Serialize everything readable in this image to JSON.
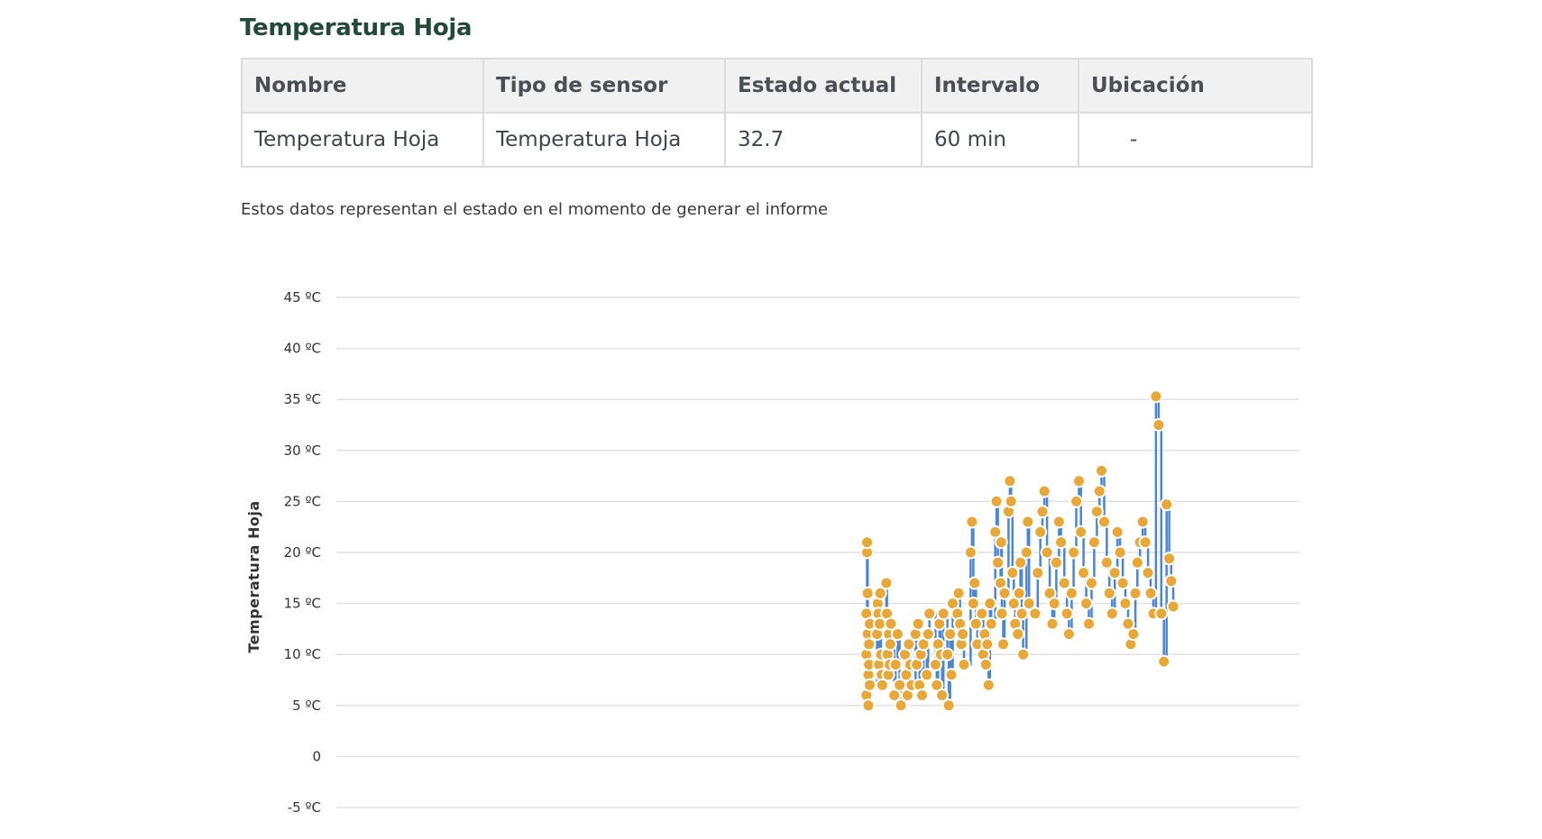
{
  "section_title": "Temperatura Hoja",
  "table": {
    "headers": [
      "Nombre",
      "Tipo de sensor",
      "Estado actual",
      "Intervalo",
      "Ubicación"
    ],
    "row": [
      "Temperatura Hoja",
      "Temperatura Hoja",
      "32.7",
      "60 min",
      "-"
    ]
  },
  "note": "Estos datos representan el estado en el momento de generar el informe",
  "colors": {
    "title": "#22493a",
    "line": "#4a86d6",
    "marker": "#e8a838",
    "grid": "#e2e2e2"
  },
  "chart_data": {
    "type": "line",
    "ylabel": "Temperatura Hoja",
    "ylim": [
      -5,
      45
    ],
    "yticks": [
      {
        "value": 45,
        "label": "45 ºC"
      },
      {
        "value": 40,
        "label": "40 ºC"
      },
      {
        "value": 35,
        "label": "35 ºC"
      },
      {
        "value": 30,
        "label": "30 ºC"
      },
      {
        "value": 25,
        "label": "25 ºC"
      },
      {
        "value": 20,
        "label": "20 ºC"
      },
      {
        "value": 15,
        "label": "15 ºC"
      },
      {
        "value": 10,
        "label": "10 ºC"
      },
      {
        "value": 5,
        "label": "5 ºC"
      },
      {
        "value": 0,
        "label": "0"
      },
      {
        "value": -5,
        "label": "-5 ºC"
      }
    ],
    "grid": true,
    "xlim": [
      0,
      100
    ],
    "series": [
      {
        "x": [
          79.8,
          79.8,
          79.8,
          79.9,
          79.9,
          80.0,
          80.0,
          80.1,
          80.1,
          80.2,
          80.2,
          80.3,
          80.3,
          81.4,
          81.5,
          81.6,
          81.7,
          81.8,
          81.9,
          82.0,
          82.1,
          82.2,
          82.8,
          82.9,
          83.0,
          83.1,
          83.2,
          83.3,
          83.4,
          83.5,
          84.0,
          84.2,
          84.5,
          84.8,
          85.0,
          85.6,
          85.8,
          86.0,
          86.2,
          86.4,
          86.6,
          87.2,
          87.4,
          87.6,
          87.8,
          88.0,
          88.2,
          88.4,
          88.9,
          89.1,
          89.3,
          90.2,
          90.4,
          90.6,
          90.8,
          91.0,
          91.2,
          91.4,
          92.0,
          92.2,
          92.4,
          92.6,
          92.8,
          93.5,
          93.7,
          93.9,
          94.1,
          94.3,
          94.5,
          95.5,
          95.7,
          95.9,
          96.1,
          96.3,
          96.5,
          97.2,
          97.4,
          97.6,
          97.8,
          98.0,
          98.2,
          98.4,
          98.6,
          99.2,
          99.4,
          99.6,
          100.0,
          100.1,
          100.2,
          100.4,
          100.6,
          101.2,
          101.4,
          101.6,
          101.8,
          102.0,
          102.2,
          102.6,
          102.8,
          103.0,
          103.2,
          103.4,
          103.9,
          104.1,
          104.3
        ],
        "y": [
          6,
          10,
          14,
          20,
          21,
          16,
          12,
          8,
          5,
          9,
          11,
          13,
          7,
          12,
          15,
          14,
          9,
          13,
          16,
          10,
          8,
          7,
          17,
          14,
          10,
          8,
          12,
          9,
          11,
          13,
          6,
          9,
          12,
          7,
          5,
          10,
          8,
          6,
          11,
          9,
          7,
          12,
          9,
          13,
          7,
          10,
          6,
          11,
          8,
          12,
          14,
          9,
          7,
          11,
          13,
          10,
          6,
          14,
          10,
          5,
          12,
          8,
          15,
          14,
          16,
          13,
          11,
          12,
          9,
          20,
          23,
          15,
          17,
          13,
          11,
          14,
          10,
          12,
          9,
          11,
          7,
          15,
          13,
          22,
          25,
          19,
          17,
          21,
          14,
          11,
          16,
          24,
          27,
          25,
          18,
          15,
          13,
          12,
          16,
          19,
          14,
          10,
          20,
          23,
          15
        ],
        "markers": true
      },
      {
        "x": [
          105.2,
          105.6,
          106.0,
          106.3,
          106.6,
          107.0,
          107.4,
          107.8,
          108.1,
          108.4,
          108.8,
          109.1,
          109.6,
          110.0,
          110.3,
          110.7,
          111.0,
          111.4,
          111.8,
          112.1,
          112.5,
          112.9,
          113.3,
          113.7,
          114.1,
          114.5,
          114.9,
          115.2,
          115.6,
          116.0,
          116.4,
          116.8,
          117.2,
          117.6,
          118.0,
          118.4,
          118.8,
          119.2,
          119.6,
          120.0,
          120.3,
          120.6,
          121.0,
          121.4,
          121.8,
          122.2,
          122.6,
          123.0,
          123.4,
          123.8,
          124.2,
          124.6,
          125.0,
          125.4,
          125.7,
          126.0
        ],
        "y": [
          14,
          18,
          22,
          24,
          26,
          20,
          16,
          13,
          15,
          19,
          23,
          21,
          17,
          14,
          12,
          16,
          20,
          25,
          27,
          22,
          18,
          15,
          13,
          17,
          21,
          24,
          26,
          28,
          23,
          19,
          16,
          14,
          18,
          22,
          20,
          17,
          15,
          13,
          11,
          12,
          16,
          19,
          21,
          23,
          21,
          18,
          16,
          14,
          35.3,
          32.5,
          14,
          9.3,
          24.7,
          19.4,
          17.2,
          14.7
        ],
        "markers": true
      }
    ]
  }
}
